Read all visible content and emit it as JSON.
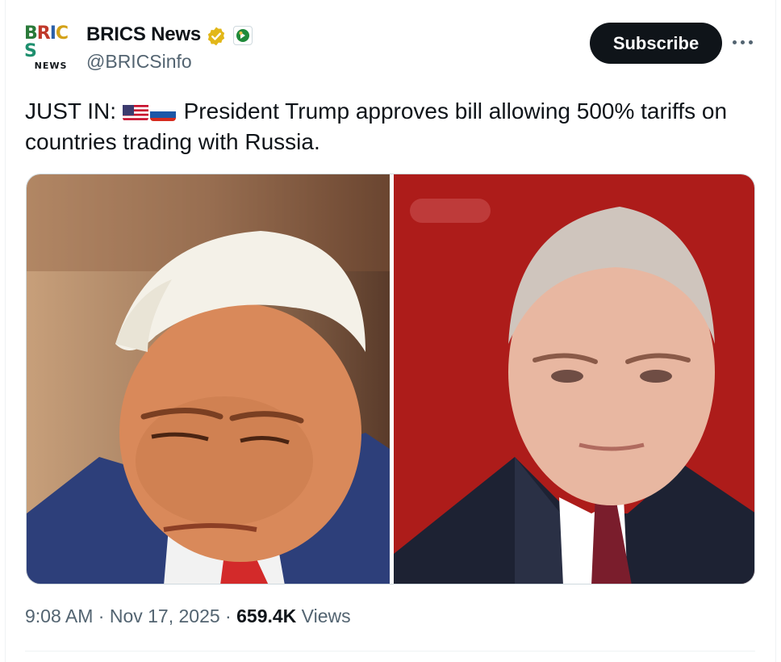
{
  "account": {
    "avatar_logo_top": "BRICS",
    "avatar_logo_bottom": "NEWS",
    "display_name": "BRICS News",
    "handle": "@BRICSinfo",
    "verified_color": "#e2b719"
  },
  "actions": {
    "subscribe_label": "Subscribe",
    "more_icon": "more-horizontal-icon"
  },
  "tweet": {
    "prefix": "JUST IN: ",
    "flags": [
      "us-flag-icon",
      "russia-flag-icon"
    ],
    "text": " President Trump approves bill allowing 500% tariffs on countries trading with Russia."
  },
  "media": {
    "images": [
      "photo-left",
      "photo-right"
    ]
  },
  "meta": {
    "time": "9:08 AM",
    "sep1": " · ",
    "date": "Nov 17, 2025",
    "sep2": " · ",
    "views_count": "659.4K",
    "views_label": " Views"
  },
  "colors": {
    "text": "#0f1419",
    "muted": "#536471",
    "border": "#cfd9de",
    "button": "#0f1419"
  }
}
